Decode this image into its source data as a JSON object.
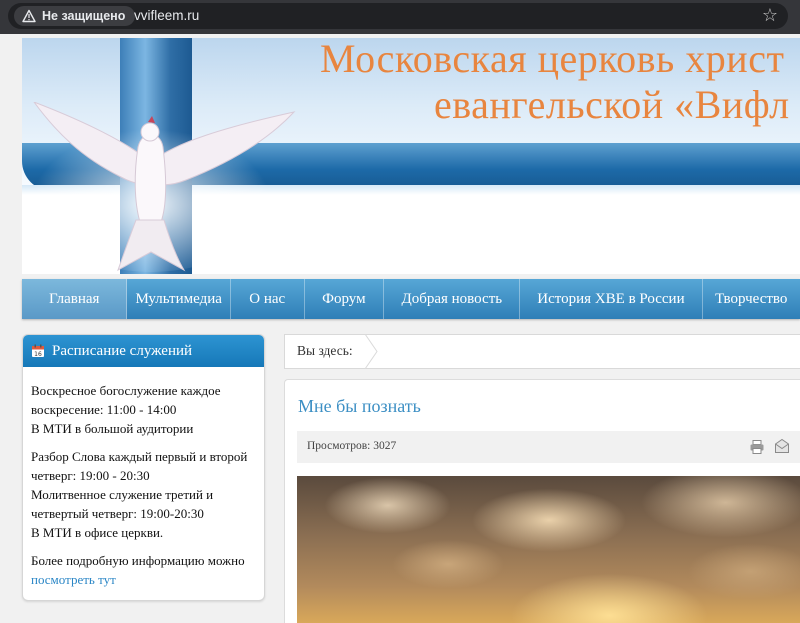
{
  "browser": {
    "security_label": "Не защищено",
    "url": "vvifleem.ru",
    "icons": [
      "warning-icon",
      "star-icon"
    ]
  },
  "header": {
    "title_line1": "Московская церковь христ",
    "title_line2": "евангельской «Вифл"
  },
  "nav": {
    "items": [
      {
        "label": "Главная",
        "active": true
      },
      {
        "label": "Мультимедиа"
      },
      {
        "label": "О нас"
      },
      {
        "label": "Форум"
      },
      {
        "label": "Добрая новость"
      },
      {
        "label": "История ХВЕ в России"
      },
      {
        "label": "Творчество"
      }
    ]
  },
  "sidebar": {
    "title": "Расписание служений",
    "icon": "calendar-icon",
    "paragraphs": [
      {
        "lines": [
          "Воскресное богослужение каждое",
          "воскресение: 11:00 - 14:00",
          "В МТИ в большой аудитории"
        ]
      },
      {
        "lines": [
          "Разбор Слова каждый первый и второй",
          "четверг: 19:00 - 20:30",
          "Молитвенное служение третий и",
          "четвертый четверг: 19:00-20:30",
          "В МТИ в офисе церкви."
        ]
      }
    ],
    "more_text": "Более подробную информацию можно",
    "more_link": "посмотреть тут"
  },
  "breadcrumb": {
    "label": "Вы здесь:"
  },
  "article": {
    "title": "Мне бы познать",
    "views": "Просмотров: 3027",
    "icons": [
      "print-icon",
      "email-icon"
    ]
  },
  "colors": {
    "nav_blue": "#2f7fb7",
    "title_orange": "#e8853f",
    "link_blue": "#2a86c6",
    "module_header": "#1678b8"
  }
}
